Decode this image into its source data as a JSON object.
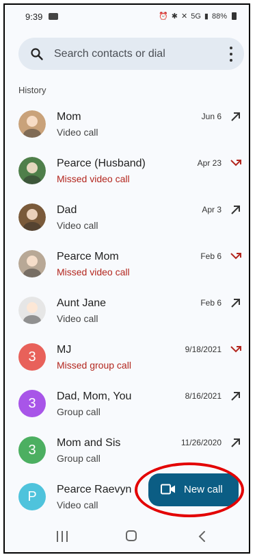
{
  "status_bar": {
    "time": "9:39",
    "battery": "88%",
    "network": "5G"
  },
  "search": {
    "placeholder": "Search contacts or dial"
  },
  "history": {
    "label": "History",
    "items": [
      {
        "name": "Mom",
        "type": "Video call",
        "date": "Jun 6",
        "status": "outgoing",
        "avatar": "photo",
        "avatar_color": "#c9a27a"
      },
      {
        "name": "Pearce (Husband)",
        "type": "Missed video call",
        "date": "Apr 23",
        "status": "missed",
        "avatar": "photo",
        "avatar_color": "#4f7f4a"
      },
      {
        "name": "Dad",
        "type": "Video call",
        "date": "Apr 3",
        "status": "outgoing",
        "avatar": "photo",
        "avatar_color": "#7a5a3a"
      },
      {
        "name": "Pearce Mom",
        "type": "Missed video call",
        "date": "Feb 6",
        "status": "missed",
        "avatar": "photo",
        "avatar_color": "#b8a896"
      },
      {
        "name": "Aunt Jane",
        "type": "Video call",
        "date": "Feb 6",
        "status": "outgoing",
        "avatar": "photo",
        "avatar_color": "#e6e6e6"
      },
      {
        "name": "MJ",
        "type": "Missed group call",
        "date": "9/18/2021",
        "status": "missed",
        "avatar": "3",
        "avatar_color": "#e8615a"
      },
      {
        "name": "Dad, Mom, You",
        "type": "Group call",
        "date": "8/16/2021",
        "status": "outgoing",
        "avatar": "3",
        "avatar_color": "#a855e8"
      },
      {
        "name": "Mom and Sis",
        "type": "Group call",
        "date": "11/26/2020",
        "status": "outgoing",
        "avatar": "3",
        "avatar_color": "#4caf61"
      },
      {
        "name": "Pearce Raevyn",
        "type": "Video call",
        "date": "",
        "status": "outgoing",
        "avatar": "P",
        "avatar_color": "#4fc3dc"
      }
    ]
  },
  "fab": {
    "label": "New call",
    "color": "#0b5d84"
  },
  "colors": {
    "missed": "#b3261e",
    "highlight_ring": "#e30000"
  },
  "icons": {
    "search": "search-icon",
    "menu": "more-vert-icon",
    "outgoing": "call-made-icon",
    "missed": "call-missed-icon",
    "video": "videocam-icon"
  }
}
